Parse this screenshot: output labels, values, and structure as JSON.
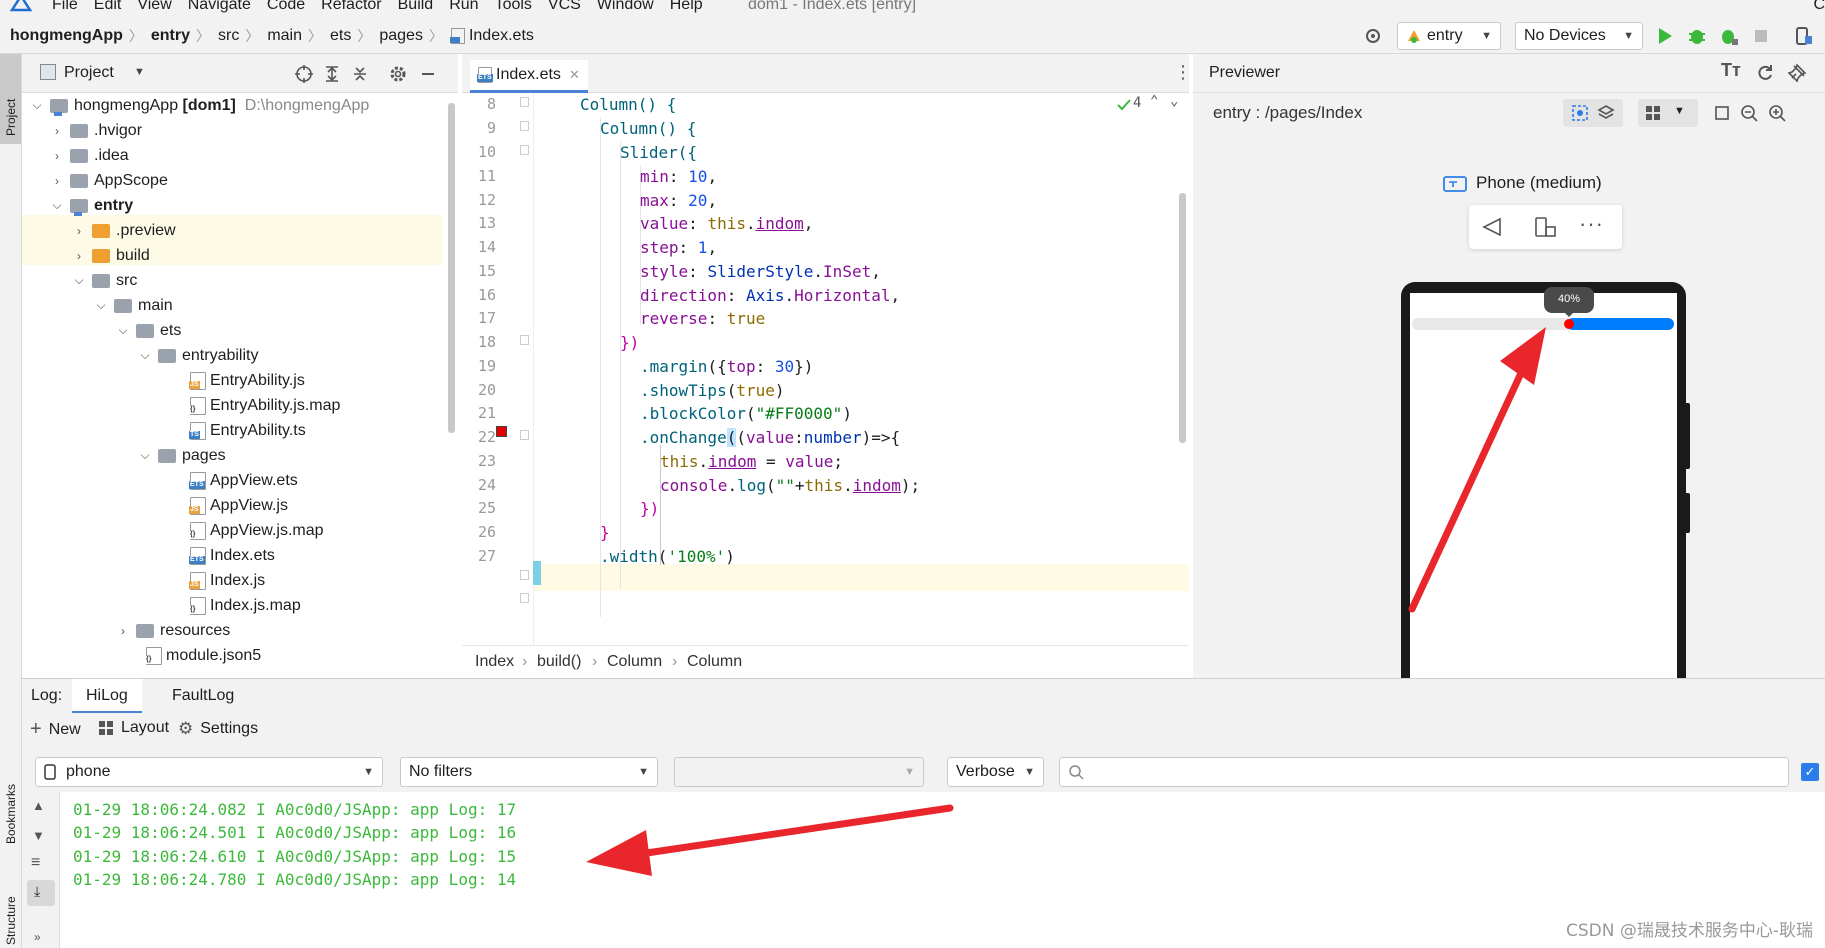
{
  "menubar": {
    "items": [
      "File",
      "Edit",
      "View",
      "Navigate",
      "Code",
      "Refactor",
      "Build",
      "Run",
      "Tools",
      "VCS",
      "Window",
      "Help"
    ],
    "window_title": "dom1 - Index.ets [entry]",
    "right_clip": "C"
  },
  "navbar": {
    "breadcrumbs": [
      "hongmengApp",
      "entry",
      "src",
      "main",
      "ets",
      "pages",
      "Index.ets"
    ],
    "module_select": "entry",
    "device_select": "No Devices"
  },
  "leftstrip": {
    "project": "Project",
    "bookmarks": "Bookmarks",
    "structure": "Structure"
  },
  "project": {
    "title": "Project",
    "tree": [
      {
        "label": "hongmengApp",
        "bold_suffix": "[dom1]",
        "path": "D:\\hongmengApp"
      },
      {
        "label": ".hvigor"
      },
      {
        "label": ".idea"
      },
      {
        "label": "AppScope"
      },
      {
        "label": "entry"
      },
      {
        "label": ".preview"
      },
      {
        "label": "build"
      },
      {
        "label": "src"
      },
      {
        "label": "main"
      },
      {
        "label": "ets"
      },
      {
        "label": "entryability"
      },
      {
        "label": "EntryAbility.js"
      },
      {
        "label": "EntryAbility.js.map"
      },
      {
        "label": "EntryAbility.ts"
      },
      {
        "label": "pages"
      },
      {
        "label": "AppView.ets"
      },
      {
        "label": "AppView.js"
      },
      {
        "label": "AppView.js.map"
      },
      {
        "label": "Index.ets"
      },
      {
        "label": "Index.js"
      },
      {
        "label": "Index.js.map"
      },
      {
        "label": "resources"
      },
      {
        "label": "module.json5"
      }
    ]
  },
  "editor": {
    "tab": "Index.ets",
    "inspection_count": "4",
    "line_numbers": [
      "8",
      "9",
      "10",
      "11",
      "12",
      "13",
      "14",
      "15",
      "16",
      "17",
      "18",
      "19",
      "20",
      "21",
      "22",
      "23",
      "24",
      "25",
      "26",
      "27"
    ],
    "code": {
      "l8": "Column() {",
      "l9": "Column() {",
      "l10": "Slider({",
      "l11a": "min",
      "l11b": "10",
      "l12a": "max",
      "l12b": "20",
      "l13a": "value",
      "l13b": "this",
      "l13c": "indom",
      "l14a": "step",
      "l14b": "1",
      "l15a": "style",
      "l15b": "SliderStyle",
      "l15c": "InSet",
      "l16a": "direction",
      "l16b": "Axis",
      "l16c": "Horizontal",
      "l17a": "reverse",
      "l17b": "true",
      "l18": "})",
      "l19a": ".margin",
      "l19b": "top",
      "l19c": "30",
      "l20a": ".showTips",
      "l20b": "true",
      "l21a": ".blockColor",
      "l21b": "\"#FF0000\"",
      "l22a": ".onChange",
      "l22b": "value",
      "l22c": "number",
      "l23a": "this",
      "l23b": "indom",
      "l23c": "value",
      "l24a": "console",
      "l24b": "log",
      "l24c": "\"\"",
      "l24d": "this",
      "l24e": "indom",
      "l25": "})",
      "l26": "}",
      "l27a": ".width",
      "l27b": "'100%'"
    },
    "breadcrumb": [
      "Index",
      "build()",
      "Column",
      "Column"
    ],
    "colors": {
      "keyword": "#0033b3",
      "property": "#871094",
      "number": "#1750eb",
      "string": "#067d17",
      "marker": "#e00000"
    }
  },
  "previewer": {
    "title": "Previewer",
    "route": "entry : /pages/Index",
    "device_label": "Phone (medium)",
    "slider_tip": "40%",
    "slider_value_fraction": 0.4,
    "block_color": "#FF0000",
    "track_color": "#007dff"
  },
  "log": {
    "label": "Log:",
    "tabs": [
      "HiLog",
      "FaultLog"
    ],
    "tool_new": "New",
    "tool_layout": "Layout",
    "tool_settings": "Settings",
    "device": "phone",
    "filter": "No filters",
    "level": "Verbose",
    "lines": [
      "01-29 18:06:24.082 I A0c0d0/JSApp: app Log: 17",
      "01-29 18:06:24.501 I A0c0d0/JSApp: app Log: 16",
      "01-29 18:06:24.610 I A0c0d0/JSApp: app Log: 15",
      "01-29 18:06:24.780 I A0c0d0/JSApp: app Log: 14"
    ],
    "line_color": "#3cb93c"
  },
  "watermark": "CSDN @瑞晟技术服务中心-耿瑞"
}
